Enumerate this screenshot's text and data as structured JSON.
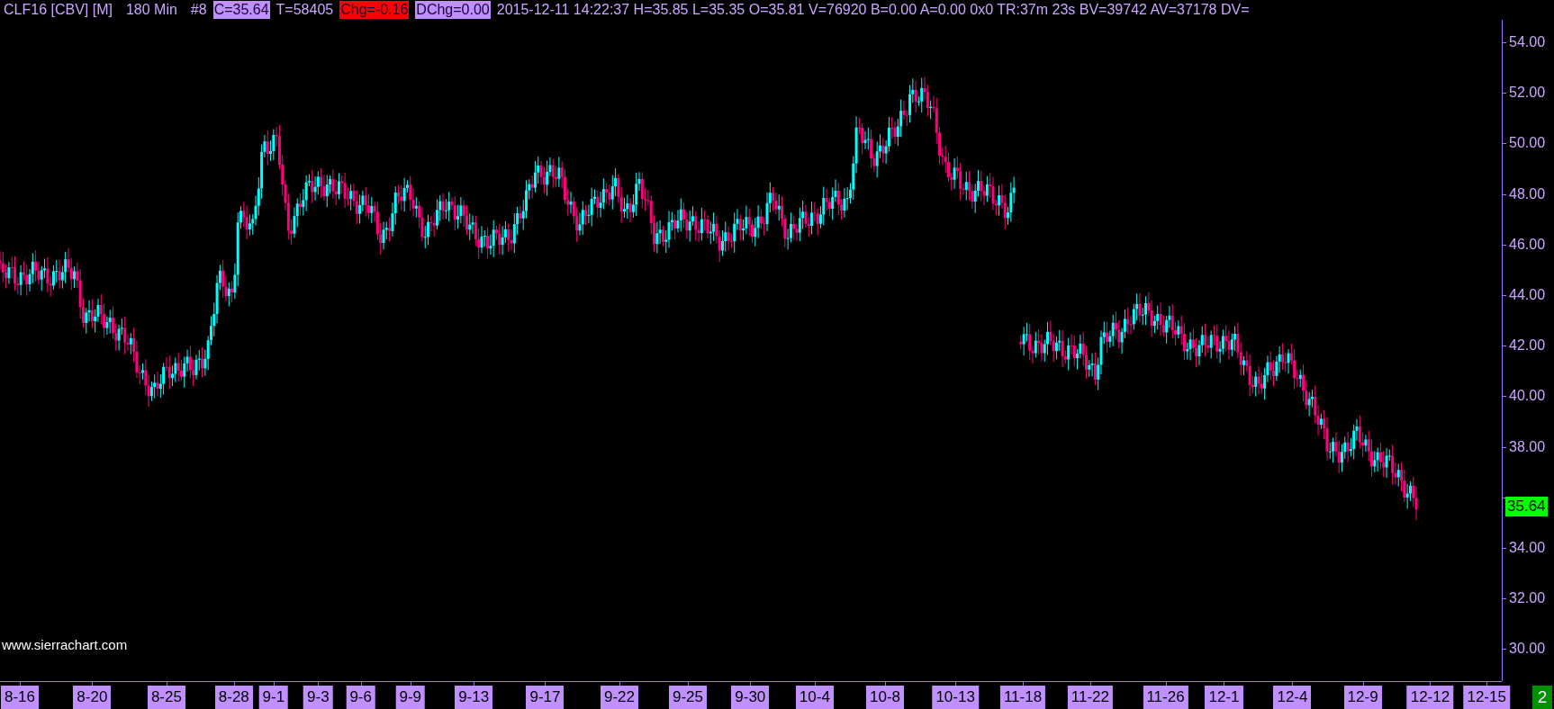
{
  "header": {
    "symbol": "CLF16 [CBV] [M]",
    "timeframe": "180 Min",
    "bar_number": "#8",
    "fields": [
      {
        "text": "C=35.64",
        "color": "#c090ff"
      },
      {
        "text": "T=58405"
      },
      {
        "text": "Chg=-0.16",
        "color": "#ff0000"
      },
      {
        "text": "DChg=0.00",
        "color": "#c090ff"
      },
      {
        "text": "2015-12-11 14:22:37 H=35.85 L=35.35 O=35.81 V=76920 B=0.00 A=0.00 0x0 TR:37m 23s BV=39742 AV=37178 DV="
      }
    ]
  },
  "price_axis": {
    "labels": [
      "54.00",
      "52.00",
      "50.00",
      "48.00",
      "46.00",
      "44.00",
      "42.00",
      "40.00",
      "38.00",
      "34.00",
      "32.00",
      "30.00"
    ],
    "last_price": "35.64"
  },
  "date_axis": {
    "labels": [
      "8-16",
      "8-20",
      "8-25",
      "8-28",
      "9-1",
      "9-3",
      "9-6",
      "9-9",
      "9-13",
      "9-17",
      "9-22",
      "9-25",
      "9-30",
      "10-4",
      "10-8",
      "10-13",
      "11-18",
      "11-22",
      "11-26",
      "12-1",
      "12-4",
      "12-9",
      "12-12",
      "12-15"
    ]
  },
  "chart_number": "2",
  "website": "www.sierrachart.com"
}
